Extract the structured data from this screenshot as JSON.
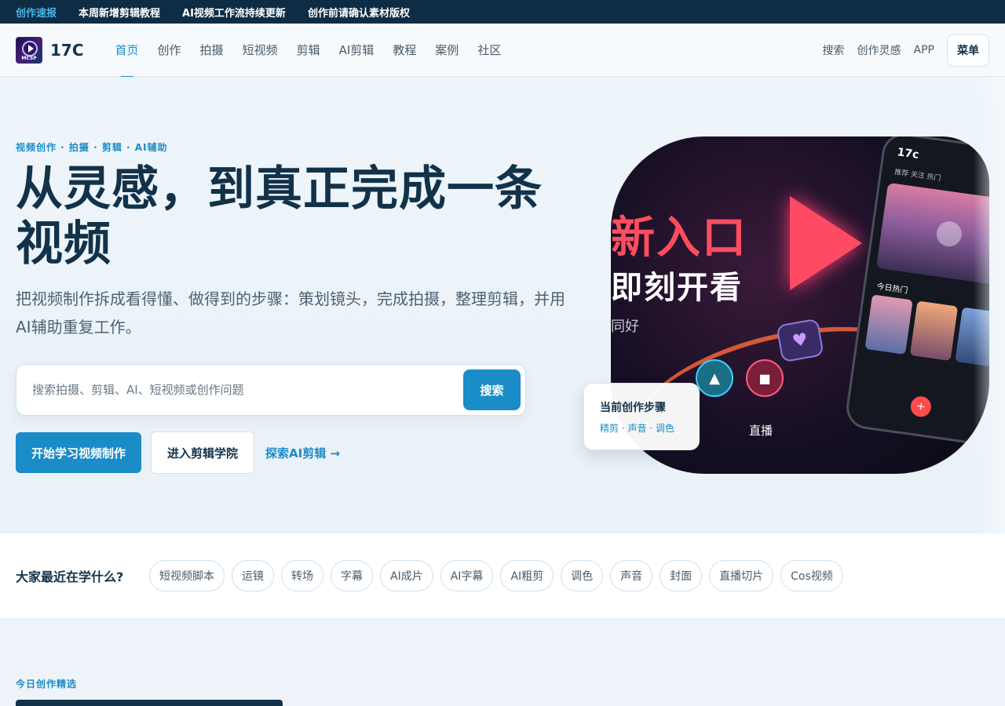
{
  "topbar": {
    "items": [
      "创作速报",
      "本周新增剪辑教程",
      "AI视频工作流持续更新",
      "创作前请确认素材版权"
    ]
  },
  "nav": {
    "logo_badge": "MCSP",
    "logo_name": "17C",
    "menu": [
      "首页",
      "创作",
      "拍摄",
      "短视频",
      "剪辑",
      "AI剪辑",
      "教程",
      "案例",
      "社区"
    ],
    "active_index": 0,
    "right_links": [
      "搜索",
      "创作灵感",
      "APP"
    ],
    "menu_button": "菜单"
  },
  "hero": {
    "eyebrow": "视频创作 · 拍摄 · 剪辑 · AI辅助",
    "title": "从灵感，到真正完成一条视频",
    "lead": "把视频制作拆成看得懂、做得到的步骤：策划镜头，完成拍摄，整理剪辑，并用AI辅助重复工作。",
    "search": {
      "placeholder": "搜索拍摄、剪辑、AI、短视频或创作问题",
      "value": "",
      "button": "搜索"
    },
    "cta_primary": "开始学习视频制作",
    "cta_secondary": "进入剪辑学院",
    "cta_link": "探索AI剪辑 →",
    "image": {
      "headline_1": "新入口",
      "headline_2": "即刻开看",
      "headline_3": "同好",
      "live_label": "直播",
      "phone_brand": "17c",
      "phone_tabs": "推荐  关注  热门",
      "phone_section": "今日热门"
    },
    "step_card": {
      "title": "当前创作步骤",
      "subtitle": "精剪 · 声音 · 调色"
    }
  },
  "popular": {
    "label": "大家最近在学什么?",
    "tags": [
      "短视频脚本",
      "运镜",
      "转场",
      "字幕",
      "AI成片",
      "AI字幕",
      "AI粗剪",
      "调色",
      "声音",
      "封面",
      "直播切片",
      "Cos视频"
    ]
  },
  "picks": {
    "eyebrow": "今日创作精选"
  },
  "colors": {
    "accent": "#1a8cc8",
    "dark": "#12324a",
    "topbar_bg": "#0e2c44"
  }
}
